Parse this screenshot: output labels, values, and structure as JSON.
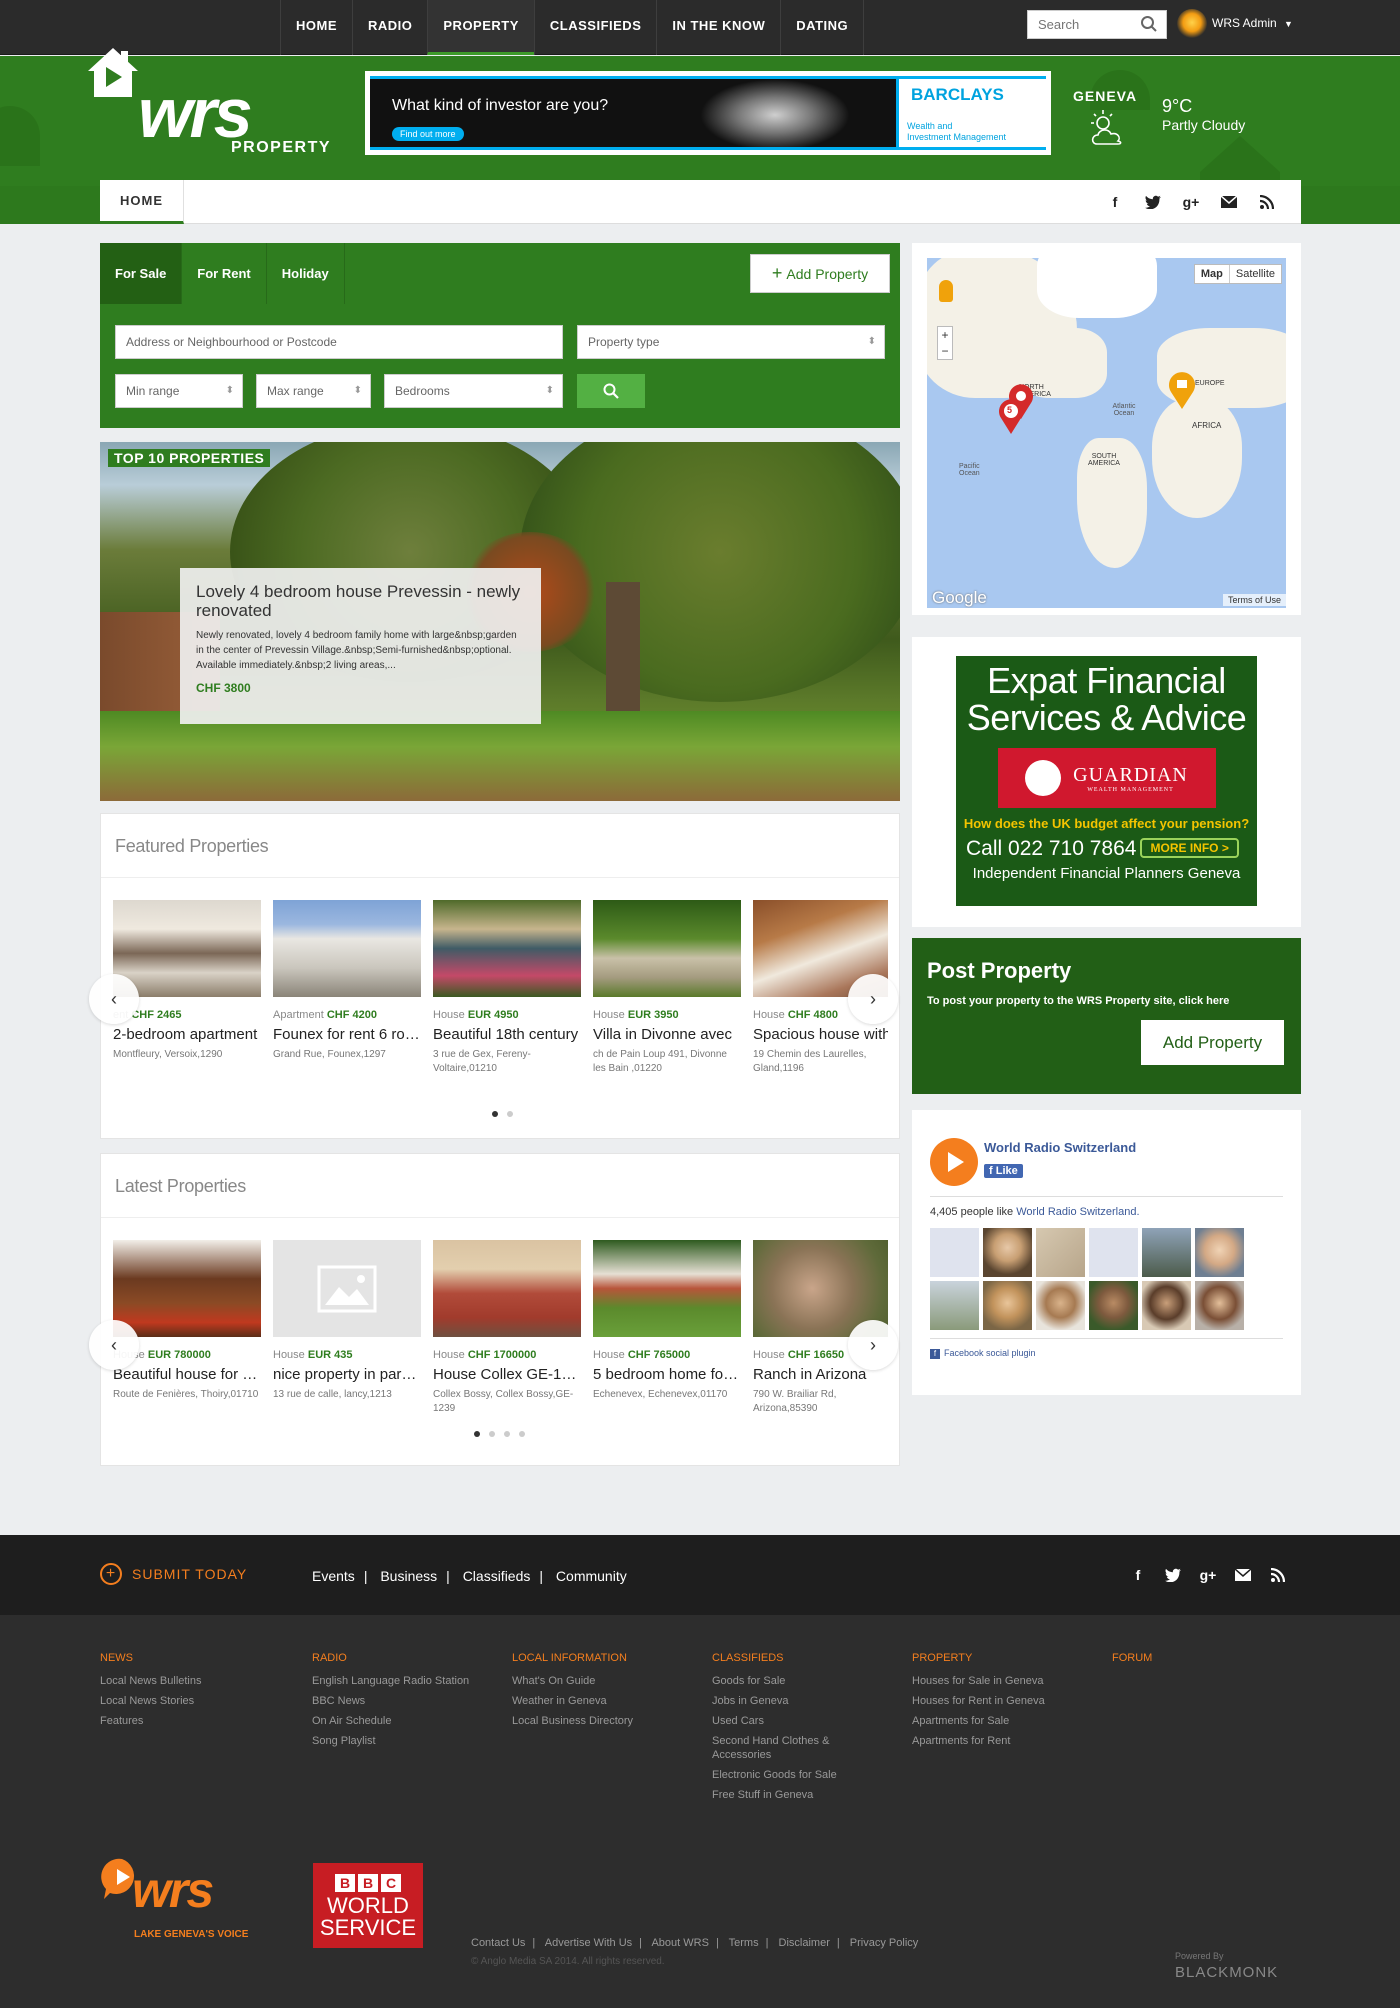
{
  "topnav": {
    "items": [
      "HOME",
      "RADIO",
      "PROPERTY",
      "CLASSIFIEDS",
      "IN THE KNOW",
      "DATING"
    ],
    "active_index": 2,
    "search_placeholder": "Search",
    "user": "WRS Admin"
  },
  "header": {
    "logo_text": "wrs",
    "logo_sub": "PROPERTY",
    "banner": {
      "question": "What kind of investor are you?",
      "cta": "Find out more",
      "brand": "BARCLAYS",
      "tagline_1": "Wealth and",
      "tagline_2": "Investment Management"
    },
    "weather": {
      "city": "GENEVA",
      "temp": "9°C",
      "condition": "Partly Cloudy",
      "icon": "partly-cloudy-icon"
    }
  },
  "subnav": {
    "home": "HOME",
    "social": [
      "facebook-icon",
      "twitter-icon",
      "google-plus-icon",
      "mail-icon",
      "rss-icon"
    ]
  },
  "search_panel": {
    "tabs": [
      "For Sale",
      "For Rent",
      "Holiday"
    ],
    "add_property": "Add Property",
    "address_placeholder": "Address or Neighbourhood or Postcode",
    "property_type": "Property type",
    "min_range": "Min range",
    "max_range": "Max range",
    "bedrooms": "Bedrooms"
  },
  "hero": {
    "badge": "TOP 10 PROPERTIES",
    "title": "Lovely 4 bedroom house Prevessin - newly renovated",
    "description": "Newly renovated, lovely 4 bedroom family home with large&nbsp;garden in the center of Prevessin Village.&nbsp;Semi-furnished&nbsp;optional. Available immediately.&nbsp;2 living areas,...",
    "price": "CHF 3800"
  },
  "featured": {
    "heading": "Featured Properties",
    "items": [
      {
        "type": "Apartment",
        "price": "CHF 2465",
        "title": "2-bedroom apartment",
        "address": "Montfleury, Versoix,1290",
        "meta_shown": "ent"
      },
      {
        "type": "Apartment",
        "price": "CHF 4200",
        "title": "Founex for rent 6 rooms",
        "address": "Grand Rue, Founex,1297"
      },
      {
        "type": "House",
        "price": "EUR 4950",
        "title": "Beautiful 18th century",
        "address": "3 rue de Gex, Fereny-Voltaire,01210"
      },
      {
        "type": "House",
        "price": "EUR 3950",
        "title": "Villa in Divonne avec",
        "address": "ch de Pain Loup 491, Divonne les Bain ,01220"
      },
      {
        "type": "House",
        "price": "CHF 4800",
        "title": "Spacious house with",
        "address": "19 Chemin des Laurelles, Gland,1196"
      }
    ],
    "dots": 2
  },
  "latest": {
    "heading": "Latest Properties",
    "items": [
      {
        "type": "House",
        "price": "EUR 780000",
        "title": "Beautiful house for sale",
        "address": "Route de Fenières, Thoiry,01710"
      },
      {
        "type": "House",
        "price": "EUR 435",
        "title": "nice property in paradise",
        "address": "13 rue de calle, lancy,1213"
      },
      {
        "type": "House",
        "price": "CHF 1700000",
        "title": "House Collex GE-1239",
        "address": "Collex Bossy, Collex Bossy,GE-1239"
      },
      {
        "type": "House",
        "price": "CHF 765000",
        "title": "5 bedroom home for sale",
        "address": "Echenevex, Echenevex,01170"
      },
      {
        "type": "House",
        "price": "CHF 16650",
        "title": "Ranch in Arizona",
        "address": "790 W. Brailiar Rd, Arizona,85390"
      }
    ],
    "dots": 4
  },
  "map": {
    "type_map": "Map",
    "type_satellite": "Satellite",
    "labels": [
      "NORTH AMERICA",
      "Atlantic Ocean",
      "EUROPE",
      "AFRICA",
      "SOUTH AMERICA",
      "Pacific Ocean"
    ],
    "cluster_count": "5",
    "brand": "Google",
    "terms": "Terms of Use"
  },
  "ad_guardian": {
    "title_1": "Expat Financial",
    "title_2": "Services & Advice",
    "brand": "GUARDIAN",
    "brand_sub": "WEALTH MANAGEMENT",
    "question": "How does the UK budget affect your pension?",
    "call": "Call 022 710 7864",
    "more": "MORE INFO >",
    "footer": "Independent Financial Planners Geneva"
  },
  "post_property": {
    "heading": "Post Property",
    "description": "To post your property to the WRS Property site, click here",
    "button": "Add Property"
  },
  "facebook": {
    "page_name": "World Radio Switzerland",
    "like": "Like",
    "count_prefix": "4,405 people like ",
    "count_link": "World Radio Switzerland.",
    "plugin": "Facebook social plugin"
  },
  "footer": {
    "submit": "SUBMIT TODAY",
    "links": [
      "Events",
      "Business",
      "Classifieds",
      "Community"
    ],
    "columns": [
      {
        "heading": "NEWS",
        "items": [
          "Local News Bulletins",
          "Local News Stories",
          "Features"
        ]
      },
      {
        "heading": "RADIO",
        "items": [
          "English Language Radio Station",
          "BBC News",
          "On Air Schedule",
          "Song Playlist"
        ]
      },
      {
        "heading": "LOCAL INFORMATION",
        "items": [
          "What's On Guide",
          "Weather in Geneva",
          "Local Business Directory"
        ]
      },
      {
        "heading": "CLASSIFIEDS",
        "items": [
          "Goods for Sale",
          "Jobs in Geneva",
          "Used Cars",
          "Second Hand Clothes & Accessories",
          "Electronic Goods for Sale",
          "Free Stuff in Geneva"
        ]
      },
      {
        "heading": "PROPERTY",
        "items": [
          "Houses for Sale in Geneva",
          "Houses for Rent in Geneva",
          "Apartments for Sale",
          "Apartments for Rent"
        ]
      },
      {
        "heading": "FORUM",
        "items": []
      }
    ],
    "wrs_tagline": "LAKE GENEVA'S VOICE",
    "bbc_letters": [
      "B",
      "B",
      "C"
    ],
    "bbc_line1": "WORLD",
    "bbc_line2": "SERVICE",
    "bottom_links": [
      "Contact Us",
      "Advertise With Us",
      "About WRS",
      "Terms",
      "Disclaimer",
      "Privacy Policy"
    ],
    "copyright": "© Anglo Media SA 2014. All rights reserved.",
    "powered_by": "Powered By",
    "powered_brand": "BLACKMONK"
  }
}
